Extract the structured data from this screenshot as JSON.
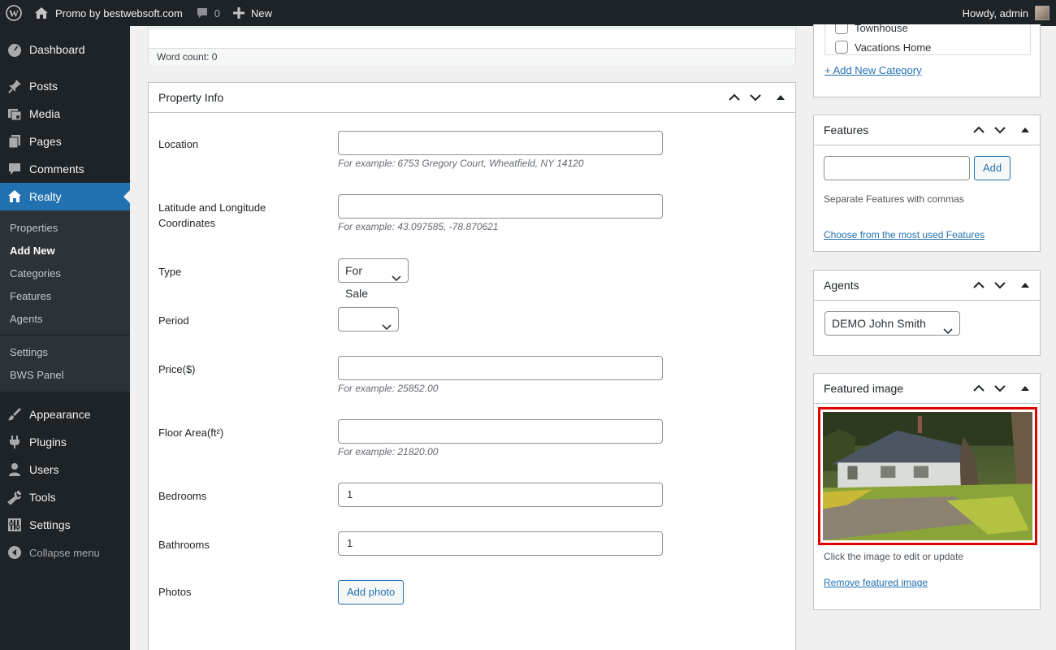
{
  "adminbar": {
    "site_name": "Promo by bestwebsoft.com",
    "comments_count": "0",
    "new_label": "New",
    "howdy": "Howdy, admin"
  },
  "sidebar": {
    "items": [
      {
        "label": "Dashboard",
        "icon": "dashboard-icon"
      },
      {
        "label": "Posts",
        "icon": "pin-icon"
      },
      {
        "label": "Media",
        "icon": "media-icon"
      },
      {
        "label": "Pages",
        "icon": "pages-icon"
      },
      {
        "label": "Comments",
        "icon": "comment-icon"
      },
      {
        "label": "Realty",
        "icon": "home-icon"
      }
    ],
    "submenu": [
      "Properties",
      "Add New",
      "Categories",
      "Features",
      "Agents",
      "Settings",
      "BWS Panel"
    ],
    "items_bottom": [
      {
        "label": "Appearance",
        "icon": "brush-icon"
      },
      {
        "label": "Plugins",
        "icon": "plugin-icon"
      },
      {
        "label": "Users",
        "icon": "users-icon"
      },
      {
        "label": "Tools",
        "icon": "wrench-icon"
      },
      {
        "label": "Settings",
        "icon": "settings-icon"
      },
      {
        "label": "Collapse menu",
        "icon": "collapse-icon"
      }
    ]
  },
  "editor": {
    "word_count": "Word count: 0"
  },
  "property_info": {
    "title": "Property Info",
    "location": {
      "label": "Location",
      "value": "",
      "hint": "For example: 6753 Gregory Court, Wheatfield, NY 14120"
    },
    "coords": {
      "label": "Latitude and Longitude Coordinates",
      "value": "",
      "hint": "For example: 43.097585, -78.870621"
    },
    "type": {
      "label": "Type",
      "value": "For Sale"
    },
    "period": {
      "label": "Period",
      "value": ""
    },
    "price": {
      "label": "Price($)",
      "value": "",
      "hint": "For example: 25852.00"
    },
    "floor_area": {
      "label": "Floor Area(ft²)",
      "value": "",
      "hint": "For example: 21820.00"
    },
    "bedrooms": {
      "label": "Bedrooms",
      "value": "1"
    },
    "bathrooms": {
      "label": "Bathrooms",
      "value": "1"
    },
    "photos": {
      "label": "Photos",
      "button": "Add photo"
    }
  },
  "categories": {
    "items": [
      "Townhouse",
      "Vacations Home"
    ],
    "add_new": "+ Add New Category"
  },
  "features": {
    "title": "Features",
    "input_value": "",
    "add_button": "Add",
    "help": "Separate Features with commas",
    "choose_link": "Choose from the most used Features"
  },
  "agents": {
    "title": "Agents",
    "selected": "DEMO John Smith"
  },
  "featured_image": {
    "title": "Featured image",
    "help": "Click the image to edit or update",
    "remove_link": "Remove featured image"
  },
  "colors": {
    "admin_dark": "#1d2327",
    "accent_blue": "#2271b1",
    "highlight_red": "#e00000"
  }
}
